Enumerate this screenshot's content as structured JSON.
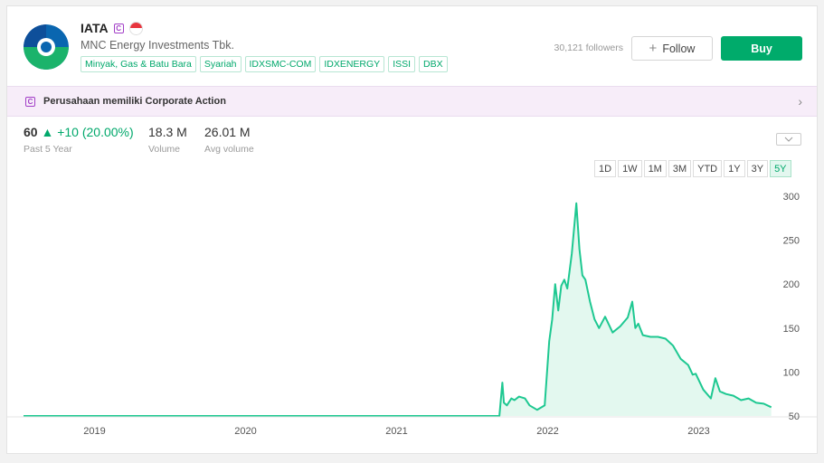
{
  "header": {
    "ticker": "IATA",
    "badge": "C",
    "company": "MNC Energy Investments Tbk.",
    "tags": [
      "Minyak, Gas & Batu Bara",
      "Syariah",
      "IDXSMC-COM",
      "IDXENERGY",
      "ISSI",
      "DBX"
    ],
    "followers": "30,121 followers",
    "follow_label": "Follow",
    "follow_icon": "+",
    "buy_label": "Buy"
  },
  "corporate_action": {
    "badge": "C",
    "text": "Perusahaan memiliki Corporate Action",
    "chevron": "›"
  },
  "stats": {
    "price": "60",
    "change": "▲ +10 (20.00%)",
    "period": "Past 5 Year",
    "volume": "18.3 M",
    "volume_label": "Volume",
    "avg_volume": "26.01 M",
    "avg_volume_label": "Avg volume"
  },
  "ranges": [
    {
      "label": "1D",
      "active": false
    },
    {
      "label": "1W",
      "active": false
    },
    {
      "label": "1M",
      "active": false
    },
    {
      "label": "3M",
      "active": false
    },
    {
      "label": "YTD",
      "active": false
    },
    {
      "label": "1Y",
      "active": false
    },
    {
      "label": "3Y",
      "active": false
    },
    {
      "label": "5Y",
      "active": true
    }
  ],
  "colors": {
    "accent": "#00ab6b",
    "line": "#1ec891",
    "fill": "#e3f8ef",
    "ca_bg": "#f7edf9",
    "ca_badge": "#a23fc7"
  },
  "chart_data": {
    "type": "area",
    "x_ticks": [
      "2019",
      "2020",
      "2021",
      "2022",
      "2023"
    ],
    "y_ticks": [
      50,
      100,
      150,
      200,
      250,
      300
    ],
    "ylim": [
      50,
      300
    ],
    "xlim": [
      2018.55,
      2023.52
    ],
    "x": [
      2018.55,
      2021.7,
      2021.72,
      2021.73,
      2021.75,
      2021.78,
      2021.8,
      2021.83,
      2021.87,
      2021.9,
      2021.95,
      2022.0,
      2022.03,
      2022.05,
      2022.07,
      2022.09,
      2022.11,
      2022.13,
      2022.15,
      2022.18,
      2022.21,
      2022.23,
      2022.25,
      2022.27,
      2022.3,
      2022.33,
      2022.36,
      2022.4,
      2022.45,
      2022.5,
      2022.55,
      2022.58,
      2022.6,
      2022.62,
      2022.65,
      2022.7,
      2022.75,
      2022.8,
      2022.85,
      2022.9,
      2022.95,
      2022.98,
      2023.0,
      2023.05,
      2023.1,
      2023.13,
      2023.16,
      2023.2,
      2023.25,
      2023.3,
      2023.35,
      2023.4,
      2023.45,
      2023.5
    ],
    "y": [
      50,
      50,
      88,
      65,
      62,
      70,
      68,
      72,
      70,
      62,
      57,
      62,
      135,
      160,
      200,
      170,
      198,
      205,
      195,
      235,
      292,
      240,
      210,
      205,
      180,
      160,
      150,
      163,
      145,
      152,
      162,
      180,
      150,
      155,
      142,
      140,
      140,
      138,
      130,
      115,
      108,
      97,
      98,
      80,
      70,
      93,
      78,
      75,
      73,
      68,
      70,
      65,
      64,
      60
    ]
  }
}
